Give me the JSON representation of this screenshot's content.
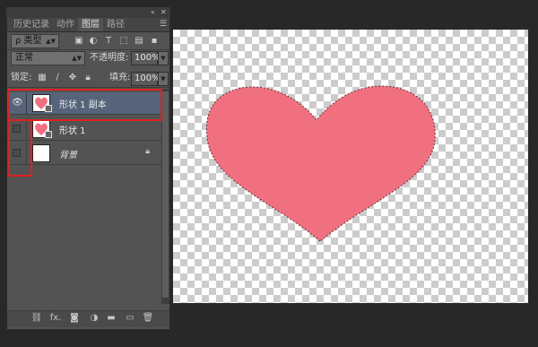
{
  "panel": {
    "tabs": [
      {
        "label": "历史记录",
        "active": false
      },
      {
        "label": "动作",
        "active": false
      },
      {
        "label": "图层",
        "active": true
      },
      {
        "label": "路径",
        "active": false
      }
    ],
    "filter": {
      "label": "ρ 类型"
    },
    "blend_mode": {
      "value": "正常"
    },
    "opacity": {
      "label": "不透明度:",
      "value": "100%"
    },
    "lock": {
      "label": "锁定:"
    },
    "fill": {
      "label": "填充:",
      "value": "100%"
    },
    "layers": [
      {
        "name": "形状 1 副本",
        "selected": true,
        "visible": true,
        "locked": false,
        "italic": false
      },
      {
        "name": "形状 1",
        "selected": false,
        "visible": false,
        "locked": false,
        "italic": false
      },
      {
        "name": "背景",
        "selected": false,
        "visible": false,
        "locked": true,
        "italic": true
      }
    ],
    "bottom_icons": [
      "link-icon",
      "fx-icon",
      "mask-icon",
      "adjustment-icon",
      "group-folder-icon",
      "new-layer-icon",
      "trash-icon"
    ],
    "bottom_labels": {
      "fx": "fx."
    }
  },
  "colors": {
    "heart": "#f07080",
    "heart_outline": "#6a2a30",
    "highlight": "#e02020",
    "selected_layer": "#56637a"
  }
}
